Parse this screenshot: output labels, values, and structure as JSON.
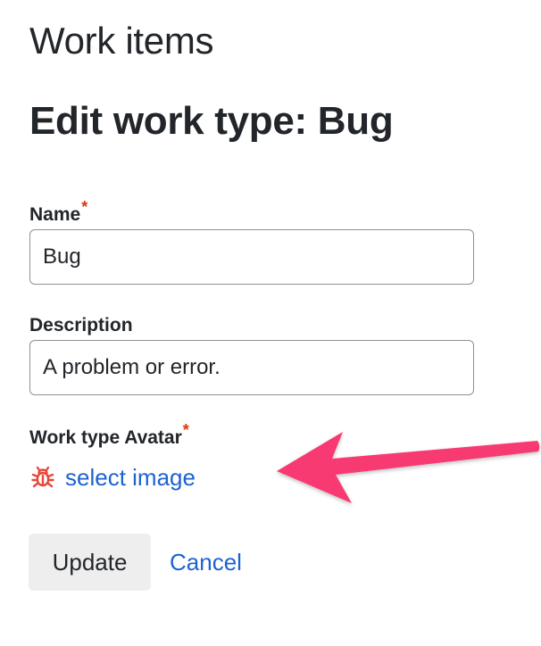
{
  "header": {
    "title": "Work items"
  },
  "form": {
    "title": "Edit work type: Bug",
    "name": {
      "label": "Name",
      "required_mark": "*",
      "value": "Bug"
    },
    "description": {
      "label": "Description",
      "value": "A problem or error."
    },
    "avatar": {
      "label": "Work type Avatar",
      "required_mark": "*",
      "icon": "bug-icon",
      "link_label": "select image"
    },
    "actions": {
      "update_label": "Update",
      "cancel_label": "Cancel"
    }
  },
  "colors": {
    "link": "#1d62d1",
    "required": "#de350b",
    "bug_icon": "#e5493a",
    "annotation_arrow": "#f73a72",
    "button_bg": "#eeeeef"
  }
}
